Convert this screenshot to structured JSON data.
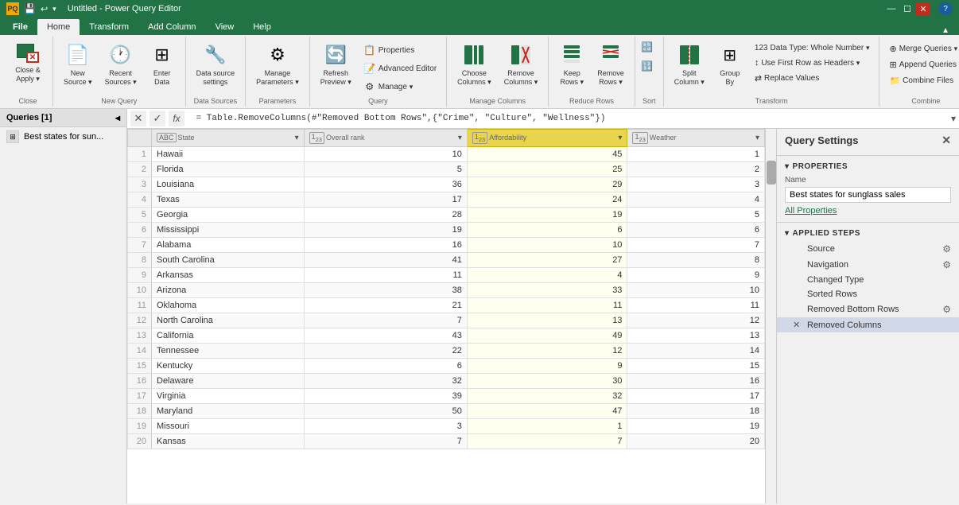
{
  "titleBar": {
    "icon": "PQ",
    "title": "Untitled - Power Query Editor",
    "controls": [
      "—",
      "☐",
      "✕"
    ]
  },
  "tabs": [
    {
      "label": "File",
      "active": false,
      "isFile": true
    },
    {
      "label": "Home",
      "active": true
    },
    {
      "label": "Transform",
      "active": false
    },
    {
      "label": "Add Column",
      "active": false
    },
    {
      "label": "View",
      "active": false
    },
    {
      "label": "Help",
      "active": false
    }
  ],
  "ribbon": {
    "groups": [
      {
        "name": "Close",
        "buttons": [
          {
            "label": "Close &\nApply",
            "type": "large",
            "icon": "✕",
            "hasDropdown": true
          }
        ]
      },
      {
        "name": "New Query",
        "buttons": [
          {
            "label": "New\nSource",
            "type": "large",
            "icon": "📄",
            "hasDropdown": true
          },
          {
            "label": "Recent\nSources",
            "type": "large",
            "icon": "🕐",
            "hasDropdown": true
          },
          {
            "label": "Enter\nData",
            "type": "large",
            "icon": "⊞"
          }
        ]
      },
      {
        "name": "Data Sources",
        "buttons": [
          {
            "label": "Data source\nsettings",
            "type": "large",
            "icon": "🔧"
          }
        ]
      },
      {
        "name": "Parameters",
        "buttons": [
          {
            "label": "Manage\nParameters",
            "type": "large",
            "icon": "⚙",
            "hasDropdown": true
          }
        ]
      },
      {
        "name": "Query",
        "buttons": [
          {
            "label": "Refresh\nPreview",
            "type": "large",
            "icon": "🔄",
            "hasDropdown": true
          },
          {
            "label": "Properties",
            "type": "small",
            "icon": "📋"
          },
          {
            "label": "Advanced Editor",
            "type": "small",
            "icon": "📝"
          },
          {
            "label": "Manage",
            "type": "small",
            "icon": "⚙",
            "hasDropdown": true
          }
        ]
      },
      {
        "name": "Manage Columns",
        "buttons": [
          {
            "label": "Choose\nColumns",
            "type": "large",
            "icon": "⊞",
            "hasDropdown": true
          },
          {
            "label": "Remove\nColumns",
            "type": "large",
            "icon": "✕",
            "hasDropdown": true
          }
        ]
      },
      {
        "name": "Reduce Rows",
        "buttons": [
          {
            "label": "Keep\nRows",
            "type": "large",
            "icon": "≡",
            "hasDropdown": true
          },
          {
            "label": "Remove\nRows",
            "type": "large",
            "icon": "✕",
            "hasDropdown": true
          }
        ]
      },
      {
        "name": "Sort",
        "buttons": [
          {
            "label": "↑",
            "type": "small",
            "icon": ""
          },
          {
            "label": "↓",
            "type": "small",
            "icon": ""
          }
        ]
      },
      {
        "name": "Transform",
        "buttons": [
          {
            "label": "Split\nColumn",
            "type": "large",
            "icon": "⋮",
            "hasDropdown": true
          },
          {
            "label": "Group\nBy",
            "type": "large",
            "icon": "≡"
          },
          {
            "label": "Data Type: Whole Number",
            "type": "small",
            "icon": ""
          },
          {
            "label": "Use First Row as Headers",
            "type": "small",
            "icon": ""
          },
          {
            "label": "Replace Values",
            "type": "small",
            "icon": ""
          }
        ]
      },
      {
        "name": "Combine",
        "buttons": [
          {
            "label": "Merge Queries",
            "type": "small",
            "icon": "",
            "hasDropdown": true
          },
          {
            "label": "Append Queries",
            "type": "small",
            "icon": "",
            "hasDropdown": true
          },
          {
            "label": "Combine Files",
            "type": "small",
            "icon": ""
          }
        ]
      }
    ]
  },
  "sidebar": {
    "title": "Queries [1]",
    "items": [
      {
        "label": "Best states for sun...",
        "icon": "⊞"
      }
    ]
  },
  "formulaBar": {
    "cancelBtn": "✕",
    "acceptBtn": "✓",
    "fxBtn": "fx",
    "formula": " = Table.RemoveColumns(#\"Removed Bottom Rows\",{\"Crime\", \"Culture\", \"Wellness\"})"
  },
  "grid": {
    "columns": [
      {
        "name": "State",
        "type": "ABC",
        "typeIcon": "ABC",
        "highlighted": false
      },
      {
        "name": "Overall rank",
        "type": "123",
        "typeIcon": "123",
        "highlighted": false
      },
      {
        "name": "Affordability",
        "type": "123",
        "typeIcon": "123",
        "highlighted": true
      },
      {
        "name": "Weather",
        "type": "123",
        "typeIcon": "123",
        "highlighted": false
      }
    ],
    "rows": [
      [
        1,
        "Hawaii",
        10,
        45,
        1
      ],
      [
        2,
        "Florida",
        5,
        25,
        2
      ],
      [
        3,
        "Louisiana",
        36,
        29,
        3
      ],
      [
        4,
        "Texas",
        17,
        24,
        4
      ],
      [
        5,
        "Georgia",
        28,
        19,
        5
      ],
      [
        6,
        "Mississippi",
        19,
        6,
        6
      ],
      [
        7,
        "Alabama",
        16,
        10,
        7
      ],
      [
        8,
        "South Carolina",
        41,
        27,
        8
      ],
      [
        9,
        "Arkansas",
        11,
        4,
        9
      ],
      [
        10,
        "Arizona",
        38,
        33,
        10
      ],
      [
        11,
        "Oklahoma",
        21,
        11,
        11
      ],
      [
        12,
        "North Carolina",
        7,
        13,
        12
      ],
      [
        13,
        "California",
        43,
        49,
        13
      ],
      [
        14,
        "Tennessee",
        22,
        12,
        14
      ],
      [
        15,
        "Kentucky",
        6,
        9,
        15
      ],
      [
        16,
        "Delaware",
        32,
        30,
        16
      ],
      [
        17,
        "Virginia",
        39,
        32,
        17
      ],
      [
        18,
        "Maryland",
        50,
        47,
        18
      ],
      [
        19,
        "Missouri",
        3,
        1,
        19
      ],
      [
        20,
        "Kansas",
        7,
        7,
        20
      ]
    ]
  },
  "querySettings": {
    "title": "Query Settings",
    "propertiesLabel": "PROPERTIES",
    "nameLabel": "Name",
    "nameValue": "Best states for sunglass sales",
    "allPropertiesLink": "All Properties",
    "appliedStepsLabel": "APPLIED STEPS",
    "steps": [
      {
        "label": "Source",
        "hasGear": true,
        "hasX": false,
        "active": false
      },
      {
        "label": "Navigation",
        "hasGear": true,
        "hasX": false,
        "active": false
      },
      {
        "label": "Changed Type",
        "hasGear": false,
        "hasX": false,
        "active": false
      },
      {
        "label": "Sorted Rows",
        "hasGear": false,
        "hasX": false,
        "active": false
      },
      {
        "label": "Removed Bottom Rows",
        "hasGear": true,
        "hasX": false,
        "active": false
      },
      {
        "label": "Removed Columns",
        "hasGear": false,
        "hasX": true,
        "active": true
      }
    ]
  },
  "icons": {
    "close": "✕",
    "minimize": "—",
    "maximize": "☐",
    "chevronDown": "▾",
    "collapse": "◂",
    "gear": "⚙",
    "x": "✕",
    "expand": "▾"
  }
}
